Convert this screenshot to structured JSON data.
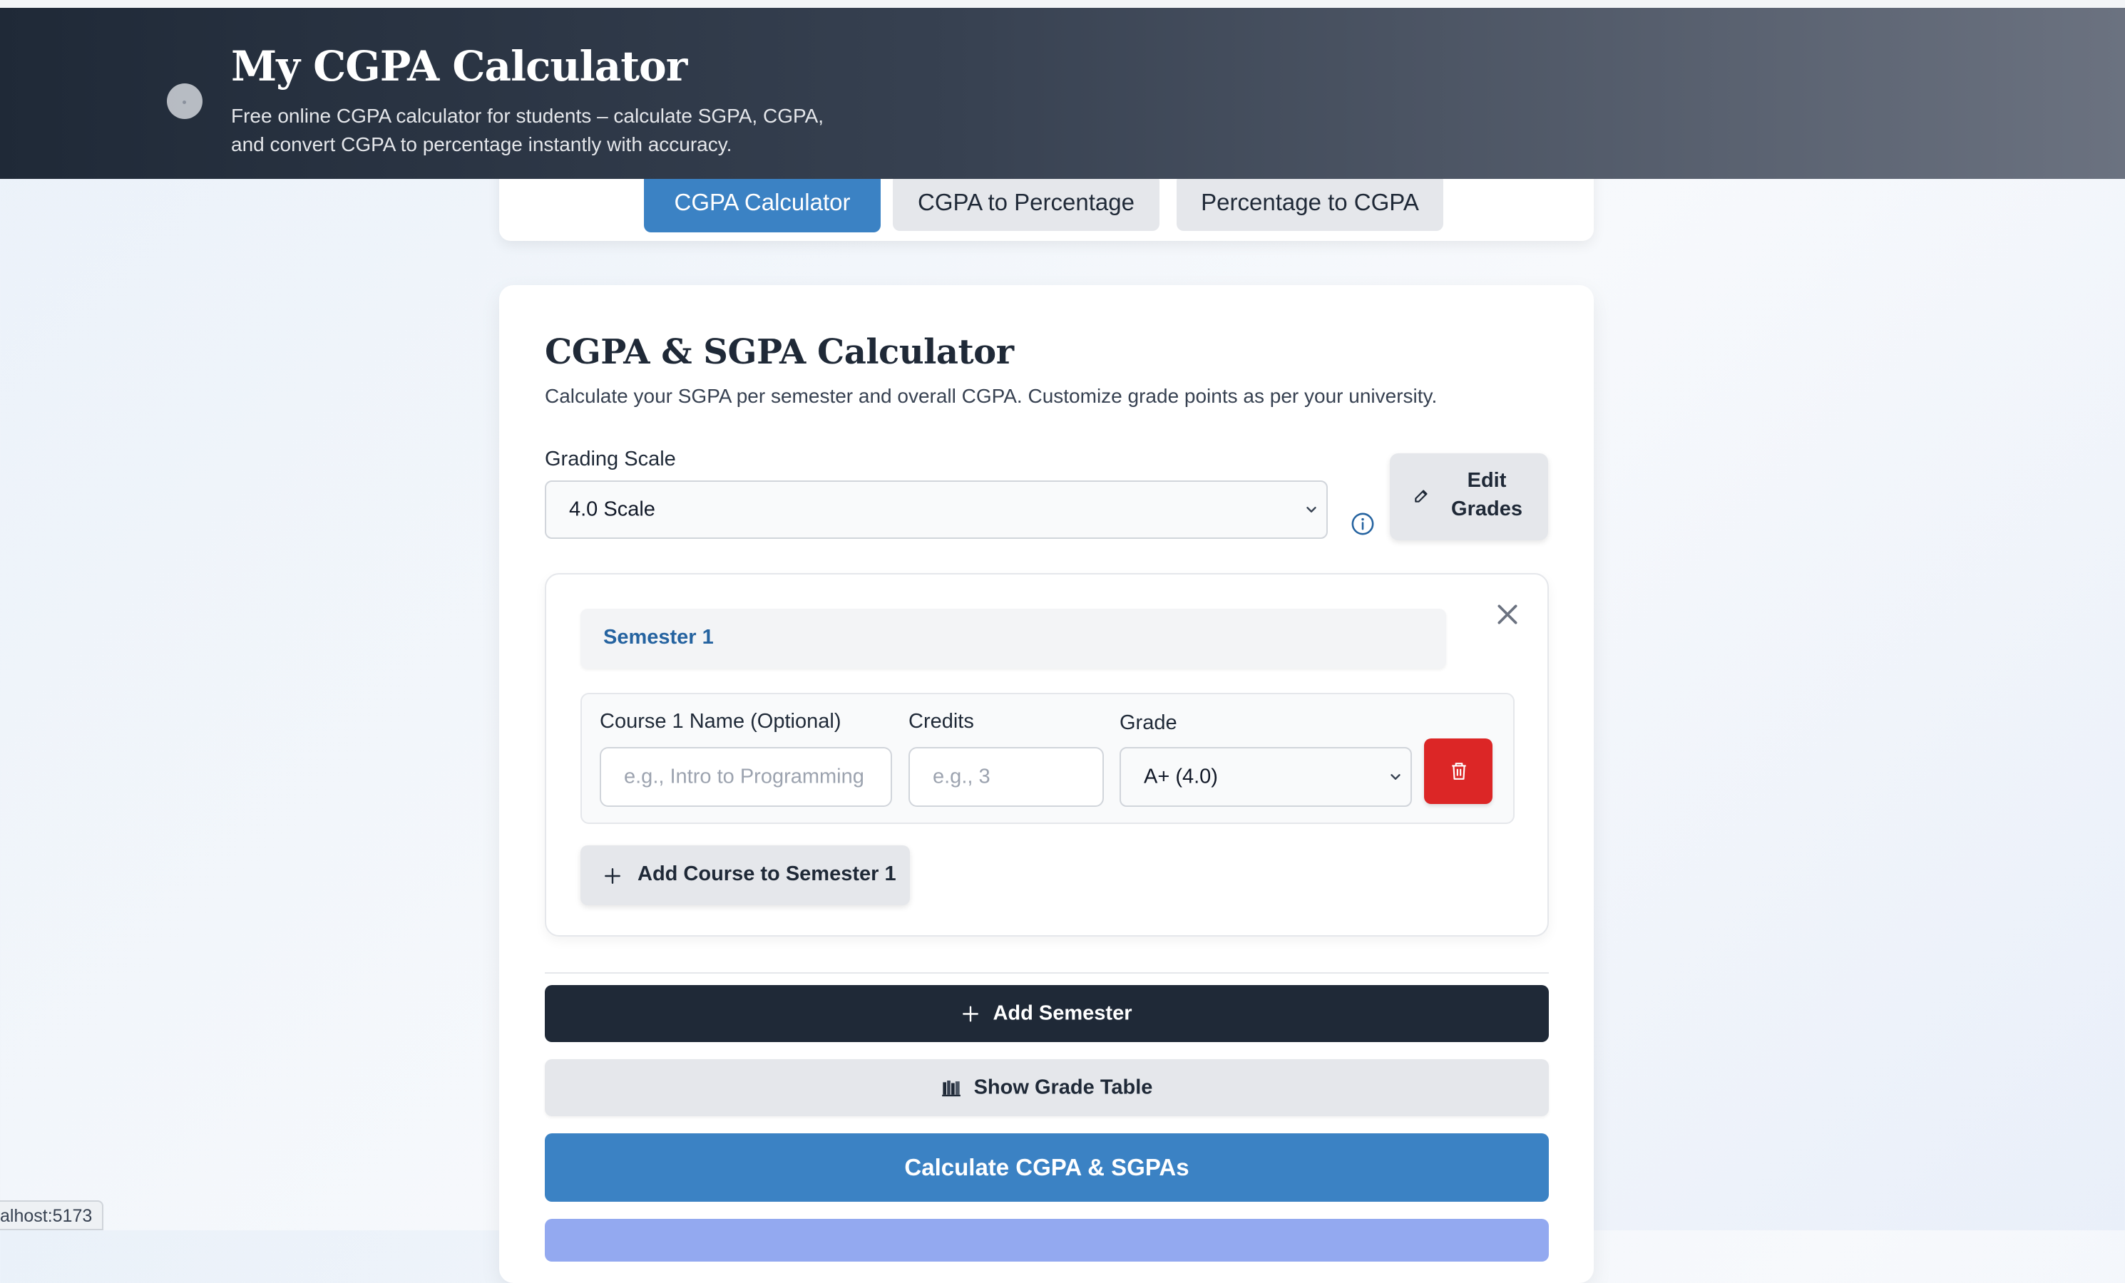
{
  "header": {
    "title": "My CGPA Calculator",
    "subtitle_line1": "Free online CGPA calculator for students – calculate SGPA, CGPA,",
    "subtitle_line2": "and convert CGPA to percentage instantly with accuracy."
  },
  "tabs": [
    {
      "label": "CGPA Calculator",
      "active": true
    },
    {
      "label": "CGPA to Percentage",
      "active": false
    },
    {
      "label": "Percentage to CGPA",
      "active": false
    }
  ],
  "calculator": {
    "title": "CGPA & SGPA Calculator",
    "description": "Calculate your SGPA per semester and overall CGPA. Customize grade points as per your university.",
    "grading_scale_label": "Grading Scale",
    "grading_scale_value": "4.0 Scale",
    "edit_grades_line1": "Edit",
    "edit_grades_line2": "Grades"
  },
  "semester": {
    "name": "Semester 1",
    "course": {
      "name_label": "Course 1 Name (Optional)",
      "name_placeholder": "e.g., Intro to Programming",
      "credits_label": "Credits",
      "credits_placeholder": "e.g., 3",
      "grade_label": "Grade",
      "grade_value": "A+ (4.0)"
    },
    "add_course_label": "Add Course to Semester 1"
  },
  "actions": {
    "add_semester": "Add Semester",
    "show_grade_table": "Show Grade Table",
    "calculate": "Calculate CGPA & SGPAs"
  },
  "status_bar": {
    "url": "alhost:5173"
  },
  "colors": {
    "header_start": "#1f2937",
    "accent_blue": "#3b82c4",
    "danger": "#dc2626",
    "dark_button": "#1f2937"
  }
}
